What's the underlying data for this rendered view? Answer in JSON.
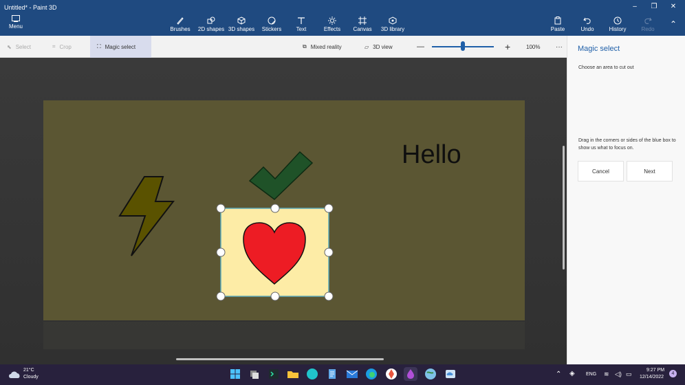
{
  "window": {
    "title": "Untitled* - Paint 3D",
    "controls": [
      "minimize-icon",
      "restore-icon",
      "close-icon"
    ]
  },
  "ribbon": {
    "menu": "Menu",
    "tools": [
      "Brushes",
      "2D shapes",
      "3D shapes",
      "Stickers",
      "Text",
      "Effects",
      "Canvas",
      "3D library"
    ],
    "actions": {
      "paste": "Paste",
      "undo": "Undo",
      "history": "History",
      "redo": "Redo"
    }
  },
  "toolbar": {
    "select": "Select",
    "crop": "Crop",
    "magic_select": "Magic select",
    "mixed_reality": "Mixed reality",
    "view_3d": "3D view",
    "zoom_minus": "—",
    "zoom_plus": "+",
    "zoom_level": "100%",
    "zoom_value": 0.5,
    "more": "···"
  },
  "canvas": {
    "text": "Hello",
    "colors": {
      "background": "#5b5633",
      "bolt": "#5a5200",
      "check": "#1f5228",
      "heart": "#ed1c24",
      "selection_bg": "#fdeca6"
    }
  },
  "panel": {
    "title": "Magic select",
    "instruction1": "Choose an area to cut out",
    "instruction2": "Drag in the corners or sides of the blue box to show us what to focus on.",
    "cancel": "Cancel",
    "next": "Next"
  },
  "taskbar": {
    "weather_temp": "21°C",
    "weather_desc": "Cloudy",
    "language": "ENG",
    "time": "9:27 PM",
    "date": "12/14/2022",
    "notification_count": "4",
    "apps": [
      "windows-start-icon",
      "task-view-icon",
      "terminal-icon",
      "file-explorer-icon",
      "canva-icon",
      "notepad-icon",
      "mail-icon",
      "edge-icon",
      "photos-icon",
      "paint3d-icon",
      "globe-icon",
      "cloud-icon"
    ]
  }
}
